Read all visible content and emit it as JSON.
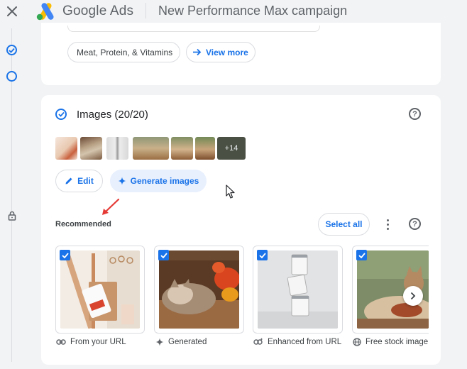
{
  "header": {
    "brand_google": "Google",
    "brand_ads": "Ads",
    "title": "New Performance Max campaign"
  },
  "colors": {
    "accent": "#1a73e8",
    "chip_bg": "#e8f0fe",
    "annotation": "#e53935",
    "page_bg": "#f1f3f4"
  },
  "topic_chip": {
    "label": "Meat, Protein, & Vitamins"
  },
  "view_more": {
    "label": "View more",
    "icon": "arrow-right-icon"
  },
  "images_section": {
    "title": "Images (20/20)",
    "more_count": "+14",
    "edit_label": "Edit",
    "generate_label": "Generate images"
  },
  "recommended": {
    "label": "Recommended",
    "select_all_label": "Select all",
    "cards": [
      {
        "source": "From your URL",
        "source_icon": "link-icon",
        "checked": true
      },
      {
        "source": "Generated",
        "source_icon": "sparkle-icon",
        "checked": true
      },
      {
        "source": "Enhanced from URL",
        "source_icon": "enhanced-link-icon",
        "checked": true
      },
      {
        "source": "Free stock image",
        "source_icon": "globe-icon",
        "checked": true
      }
    ]
  }
}
